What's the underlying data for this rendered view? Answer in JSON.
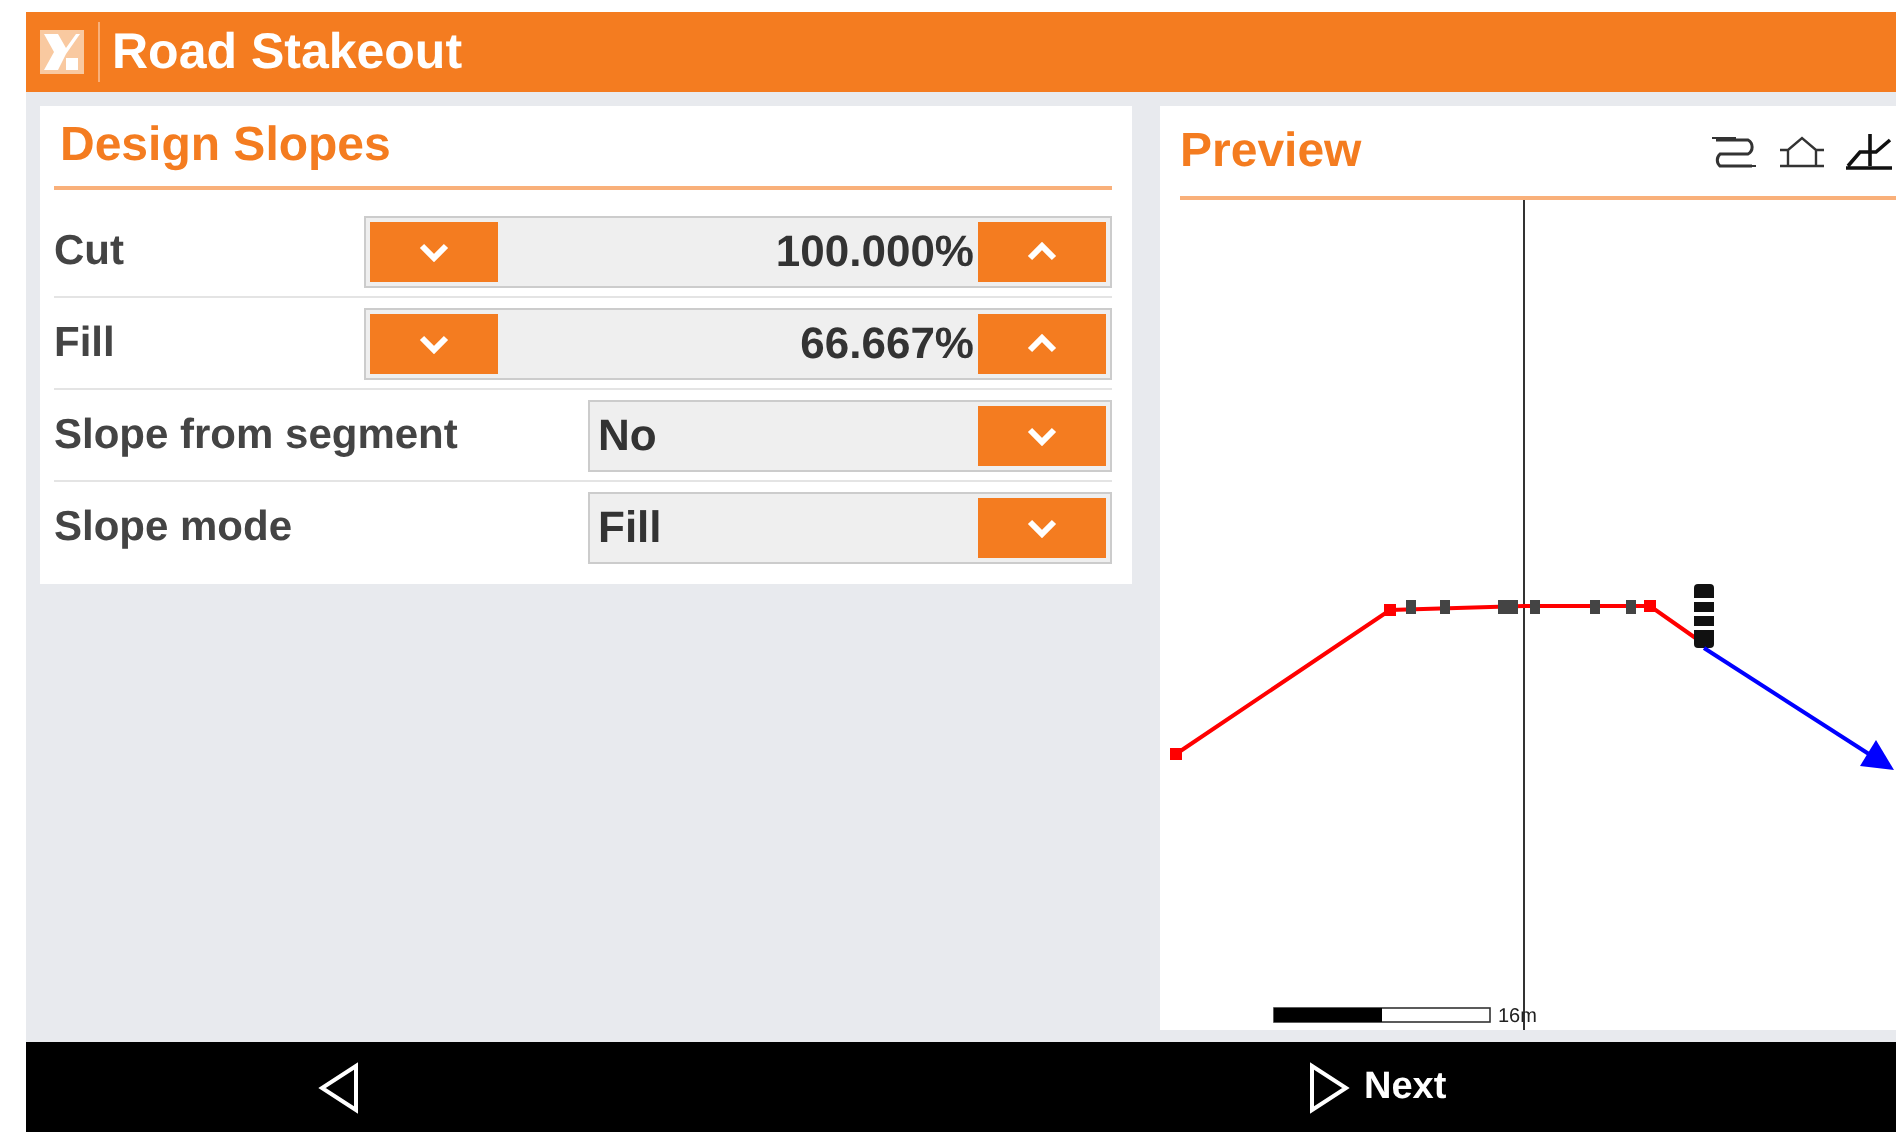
{
  "window": {
    "title": "Road Stakeout"
  },
  "design_slopes": {
    "title": "Design Slopes",
    "rows": [
      {
        "kind": "spinner",
        "label": "Cut",
        "value": "100.000%"
      },
      {
        "kind": "spinner",
        "label": "Fill",
        "value": "66.667%"
      },
      {
        "kind": "dropdown",
        "label": "Slope from segment",
        "value": "No"
      },
      {
        "kind": "dropdown",
        "label": "Slope mode",
        "value": "Fill"
      }
    ]
  },
  "preview": {
    "title": "Preview",
    "scale_label": "16m"
  },
  "bottom_bar": {
    "next": "Next"
  }
}
